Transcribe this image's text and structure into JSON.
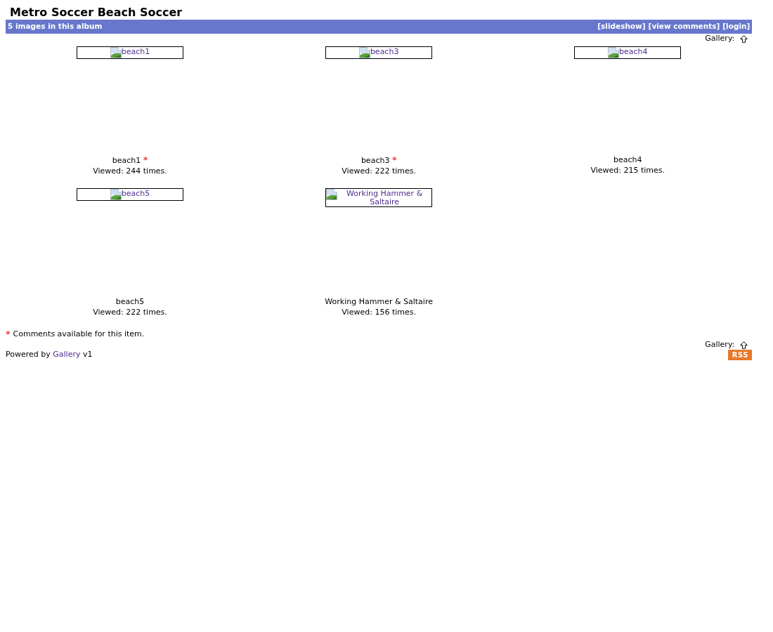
{
  "title": "Metro Soccer Beach Soccer",
  "album_bar": {
    "count_text": "5 images in this album",
    "links": [
      "[slideshow]",
      "[view comments]",
      "[login]"
    ]
  },
  "gallery_nav_top": {
    "label": "Gallery:"
  },
  "items": [
    {
      "alt": "beach1",
      "title": "beach1",
      "comment_mark": "*",
      "views": "Viewed: 244 times."
    },
    {
      "alt": "beach3",
      "title": "beach3",
      "comment_mark": "*",
      "views": "Viewed: 222 times."
    },
    {
      "alt": "beach4",
      "title": "beach4",
      "views": "Viewed: 215 times."
    },
    {
      "alt": "beach5",
      "title": "beach5",
      "views": "Viewed: 222 times."
    },
    {
      "alt": "Working Hammer & Saltaire",
      "title": "Working Hammer & Saltaire",
      "views": "Viewed: 156 times."
    }
  ],
  "legend": {
    "mark": "*",
    "text": "Comments available for this item."
  },
  "gallery_nav_bottom": {
    "label": "Gallery:"
  },
  "footer": {
    "prefix": "Powered by",
    "link": "Gallery",
    "suffix": "v1",
    "rss": "RSS"
  }
}
